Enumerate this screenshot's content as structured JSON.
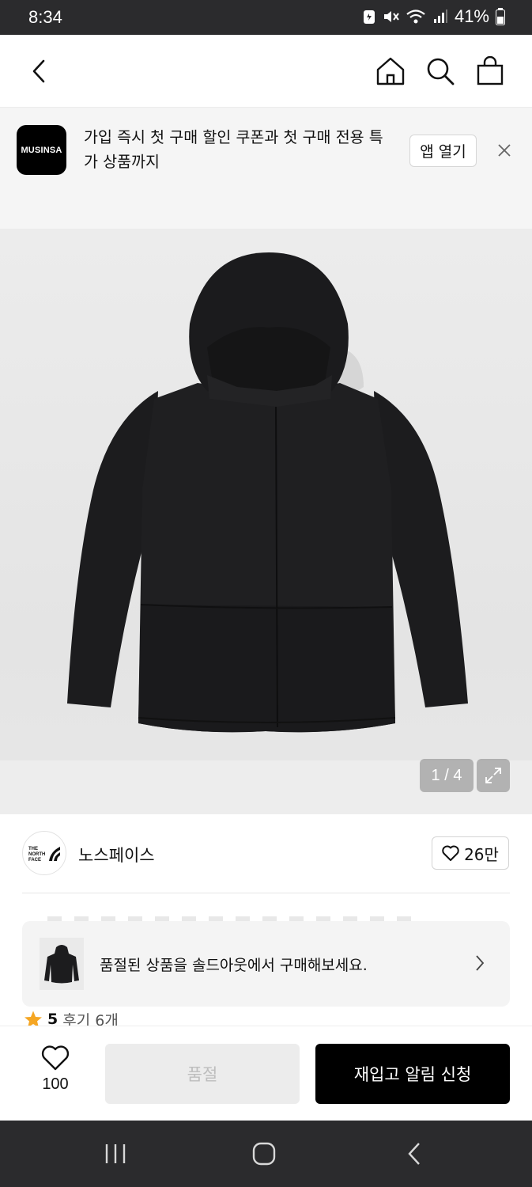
{
  "status_bar": {
    "time": "8:34",
    "battery": "41%"
  },
  "header": {
    "back_icon": "chevron-left-icon",
    "home_icon": "home-icon",
    "search_icon": "search-icon",
    "cart_icon": "shopping-bag-icon"
  },
  "banner": {
    "logo_text": "MUSINSA",
    "message": "가입 즉시 첫 구매 할인 쿠폰과 첫 구매 전용 특가 상품까지",
    "open_label": "앱 열기",
    "close_icon": "close-icon"
  },
  "product_image": {
    "counter": "1 / 4",
    "expand_icon": "expand-icon"
  },
  "brand": {
    "logo_text": "THE NORTH FACE",
    "name": "노스페이스",
    "likes": "26만"
  },
  "soldout_card": {
    "text": "품절된 상품을 솔드아웃에서 구매해보세요."
  },
  "rating": {
    "score": "5",
    "reviews": "후기 6개"
  },
  "actions": {
    "wish_count": "100",
    "soldout_label": "품절",
    "restock_label": "재입고 알림 신청"
  },
  "colors": {
    "primary": "#000000",
    "star": "#f5a623"
  }
}
